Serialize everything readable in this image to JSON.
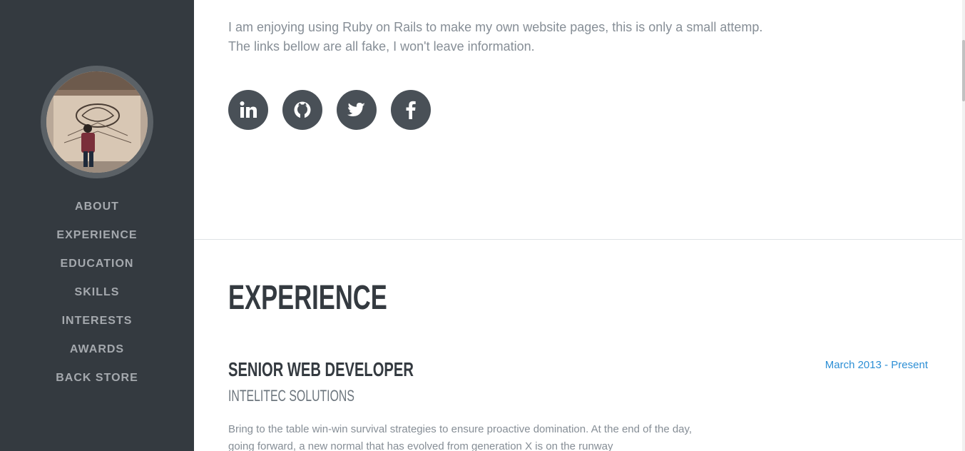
{
  "sidebar": {
    "nav": [
      {
        "label": "About"
      },
      {
        "label": "Experience"
      },
      {
        "label": "Education"
      },
      {
        "label": "Skills"
      },
      {
        "label": "Interests"
      },
      {
        "label": "Awards"
      },
      {
        "label": "Back Store"
      }
    ]
  },
  "intro": {
    "line1": "I am enjoying using Ruby on Rails to make my own website pages, this is only a small attemp.",
    "line2": "The links bellow are all fake, I won't leave information."
  },
  "social": [
    {
      "icon": "linkedin-icon"
    },
    {
      "icon": "github-icon"
    },
    {
      "icon": "twitter-icon"
    },
    {
      "icon": "facebook-icon"
    }
  ],
  "experience": {
    "heading": "Experience",
    "job": {
      "title": "Senior Web Developer",
      "company": "Intelitec Solutions",
      "date": "March 2013 - Present",
      "description": "Bring to the table win-win survival strategies to ensure proactive domination. At the end of the day, going forward, a new normal that has evolved from generation X is on the runway"
    }
  },
  "colors": {
    "sidebar_bg": "#343a40",
    "accent": "#2d8fd5",
    "social_bg": "#495057"
  }
}
